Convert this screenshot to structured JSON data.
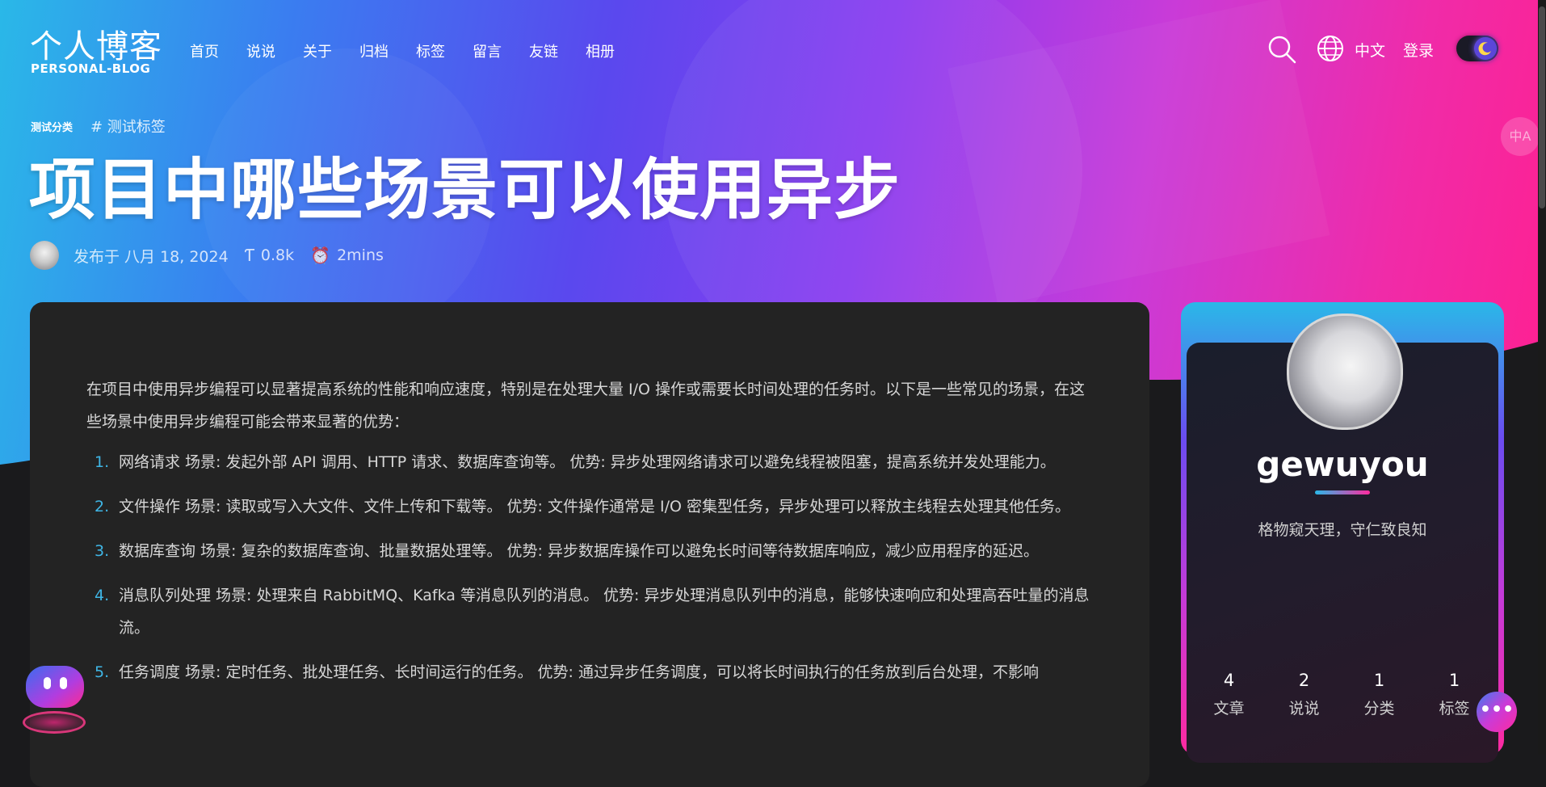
{
  "header": {
    "logo_cn": "个人博客",
    "logo_en": "PERSONAL-BLOG",
    "nav": [
      "首页",
      "说说",
      "关于",
      "归档",
      "标签",
      "留言",
      "友链",
      "相册"
    ],
    "lang": "中文",
    "login": "登录",
    "translate": "中A"
  },
  "post": {
    "category": "测试分类",
    "tag": "# 测试标签",
    "title": "项目中哪些场景可以使用异步",
    "published": "发布于 八月 18, 2024",
    "words": "0.8k",
    "read_time": "2mins",
    "intro": "在项目中使用异步编程可以显著提高系统的性能和响应速度，特别是在处理大量 I/O 操作或需要长时间处理的任务时。以下是一些常见的场景，在这些场景中使用异步编程可能会带来显著的优势：",
    "items": [
      {
        "num": "1.",
        "text": "网络请求 场景: 发起外部 API 调用、HTTP 请求、数据库查询等。 优势: 异步处理网络请求可以避免线程被阻塞，提高系统并发处理能力。"
      },
      {
        "num": "2.",
        "text": "文件操作 场景: 读取或写入大文件、文件上传和下载等。 优势: 文件操作通常是 I/O 密集型任务，异步处理可以释放主线程去处理其他任务。"
      },
      {
        "num": "3.",
        "text": "数据库查询 场景: 复杂的数据库查询、批量数据处理等。 优势: 异步数据库操作可以避免长时间等待数据库响应，减少应用程序的延迟。"
      },
      {
        "num": "4.",
        "text": "消息队列处理 场景: 处理来自 RabbitMQ、Kafka 等消息队列的消息。 优势: 异步处理消息队列中的消息，能够快速响应和处理高吞吐量的消息流。"
      },
      {
        "num": "5.",
        "text": "任务调度 场景: 定时任务、批处理任务、长时间运行的任务。 优势: 通过异步任务调度，可以将长时间执行的任务放到后台处理，不影响"
      }
    ]
  },
  "profile": {
    "name": "gewuyou",
    "motto": "格物窥天理，守仁致良知",
    "stats": [
      {
        "num": "4",
        "label": "文章"
      },
      {
        "num": "2",
        "label": "说说"
      },
      {
        "num": "1",
        "label": "分类"
      },
      {
        "num": "1",
        "label": "标签"
      }
    ]
  },
  "colors": {
    "accent_blue": "#2ab8e8",
    "accent_pink": "#ff2aa0",
    "list_number": "#3fb6e6",
    "card_bg": "#232323",
    "page_bg": "#1a1a1c"
  },
  "icons": {
    "search": "search-icon",
    "globe": "globe-icon",
    "theme": "moon-icon",
    "words": "text-icon",
    "time": "clock-icon",
    "more": "ellipsis-icon",
    "translate": "translate-icon"
  }
}
